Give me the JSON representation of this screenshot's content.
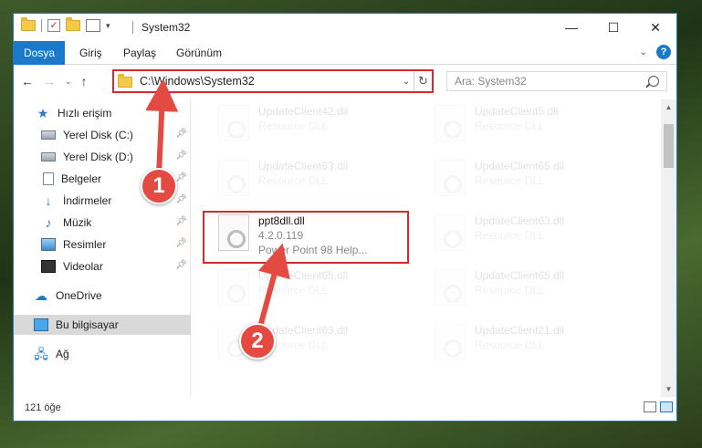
{
  "window": {
    "title": "System32",
    "controls": {
      "minimize": "—",
      "maximize": "☐",
      "close": "✕"
    }
  },
  "ribbon": {
    "tabs": [
      "Dosya",
      "Giriş",
      "Paylaş",
      "Görünüm"
    ],
    "help": "?"
  },
  "address": {
    "path": "C:\\Windows\\System32",
    "search_placeholder": "Ara: System32"
  },
  "sidebar": {
    "items": [
      {
        "label": "Hızlı erişim",
        "icon": "star-icon",
        "pinned": false
      },
      {
        "label": "Yerel Disk (C:)",
        "icon": "drive-icon",
        "pinned": true
      },
      {
        "label": "Yerel Disk (D:)",
        "icon": "drive-icon",
        "pinned": true
      },
      {
        "label": "Belgeler",
        "icon": "documents-icon",
        "pinned": true
      },
      {
        "label": "İndirmeler",
        "icon": "download-icon",
        "pinned": true
      },
      {
        "label": "Müzik",
        "icon": "music-icon",
        "pinned": true
      },
      {
        "label": "Resimler",
        "icon": "pictures-icon",
        "pinned": true
      },
      {
        "label": "Videolar",
        "icon": "videos-icon",
        "pinned": true
      },
      {
        "label": "OneDrive",
        "icon": "cloud-icon",
        "pinned": false
      },
      {
        "label": "Bu bilgisayar",
        "icon": "computer-icon",
        "pinned": false,
        "selected": true
      },
      {
        "label": "Ağ",
        "icon": "network-icon",
        "pinned": false
      }
    ]
  },
  "files": [
    {
      "name": "UpdateClient42.dll",
      "desc": "Resource DLL",
      "faded": true
    },
    {
      "name": "UpdateClient5.dll",
      "desc": "Resource DLL",
      "faded": true
    },
    {
      "name": "UpdateClient63.dll",
      "desc": "Resource DLL",
      "faded": true
    },
    {
      "name": "UpdateClient65.dll",
      "desc": "Resource DLL",
      "faded": true
    },
    {
      "name": "ppt8dll.dll",
      "desc": "4.2.0.119",
      "extra": "Power Point 98 Help...",
      "faded": false
    },
    {
      "name": "UpdateClient63.dll",
      "desc": "Resource DLL",
      "faded": true
    },
    {
      "name": "UpdateClient65.dll",
      "desc": "Resource DLL",
      "faded": true
    },
    {
      "name": "UpdateClient65.dll",
      "desc": "Resource DLL",
      "faded": true
    },
    {
      "name": "UpdateClient63.dll",
      "desc": "Resource DLL",
      "faded": true
    },
    {
      "name": "UpdateClient21.dll",
      "desc": "Resource DLL",
      "faded": true
    }
  ],
  "status": {
    "count": "121 öğe"
  },
  "callouts": {
    "step1": "1",
    "step2": "2"
  },
  "colors": {
    "accent": "#1979ca",
    "highlight": "#d42a2a",
    "badge": "#e34a41"
  }
}
